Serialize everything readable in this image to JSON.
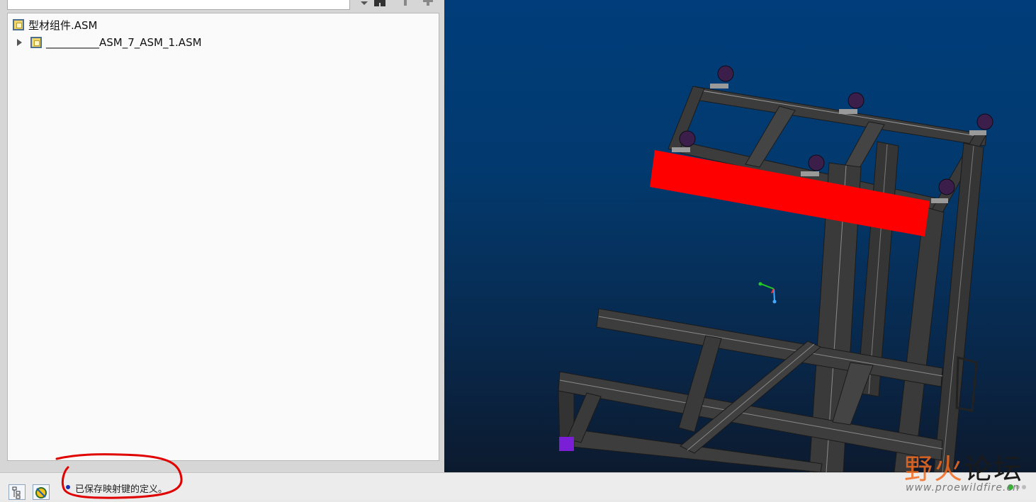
{
  "model_tree": {
    "items": [
      {
        "label": "型材组件.ASM",
        "expandable": false,
        "icon": "assembly-icon"
      },
      {
        "label": "__________ASM_7_ASM_1.ASM",
        "expandable": true,
        "icon": "assembly-icon"
      }
    ]
  },
  "status_bar": {
    "message": "已保存映射键的定义。",
    "buttons": [
      "model-tree-icon",
      "regenerate-icon"
    ]
  },
  "watermark": {
    "brand_part1": "野火",
    "brand_part2": "论坛",
    "url": "www.proewildfire.cn"
  },
  "colors": {
    "viewport_top": "#003d7a",
    "viewport_bottom": "#0c1a2e",
    "highlight_part": "#ff0000",
    "frame_profile": "#3a3a3a",
    "annotation_circle": "#e00000",
    "brand_orange": "#f26b21"
  }
}
